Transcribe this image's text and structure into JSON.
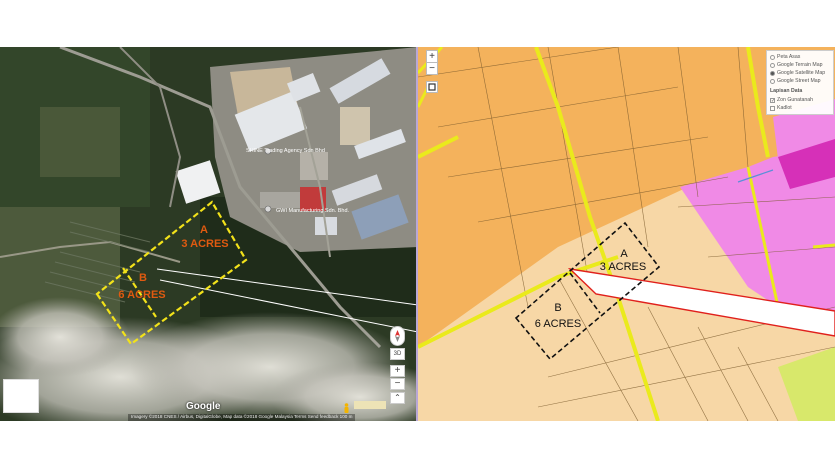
{
  "left_map": {
    "labels": {
      "shine": "SHINE Trading Agency Sdn Bhd",
      "cwi": "GWI Manufacturing Sdn. Bhd."
    },
    "plot_a": {
      "letter": "A",
      "size": "3 ACRES"
    },
    "plot_b": {
      "letter": "B",
      "size": "6 ACRES"
    },
    "google_logo": "Google",
    "attribution": "Imagery ©2018 CNES / Airbus, DigitalGlobe, Map data ©2018 Google    Malaysia    Terms    Send feedback    100 m",
    "controls": {
      "compass_icon": "compass-icon",
      "tilt_label": "3D",
      "zoom_in": "+",
      "zoom_out": "−",
      "pegman_icon": "pegman-icon"
    }
  },
  "right_map": {
    "plot_a": {
      "letter": "A",
      "size": "3 ACRES"
    },
    "plot_b": {
      "letter": "B",
      "size": "6 ACRES"
    },
    "zoom_in": "+",
    "zoom_out": "−",
    "fullscreen_icon": "fullscreen-icon",
    "legend": {
      "base_layers": [
        {
          "label": "Peta Asas",
          "selected": false
        },
        {
          "label": "Google Terrain Map",
          "selected": false
        },
        {
          "label": "Google Satellite Map",
          "selected": true
        },
        {
          "label": "Google Street Map",
          "selected": false
        }
      ],
      "data_title": "Lapisan Data",
      "data_layers": [
        {
          "label": "Zon Gunatanah",
          "checked": true
        },
        {
          "label": "Kadlot",
          "checked": false
        }
      ]
    }
  },
  "colors": {
    "plot_outline_left": "#f2e21a",
    "plot_text_left": "#e05a10",
    "plot_outline_right": "#111111",
    "land_orange": "#f4b25c",
    "land_light": "#f7d7a6",
    "road_yellow": "#eaea1c",
    "zone_pink": "#f08ae6",
    "red_line": "#e0201c"
  }
}
